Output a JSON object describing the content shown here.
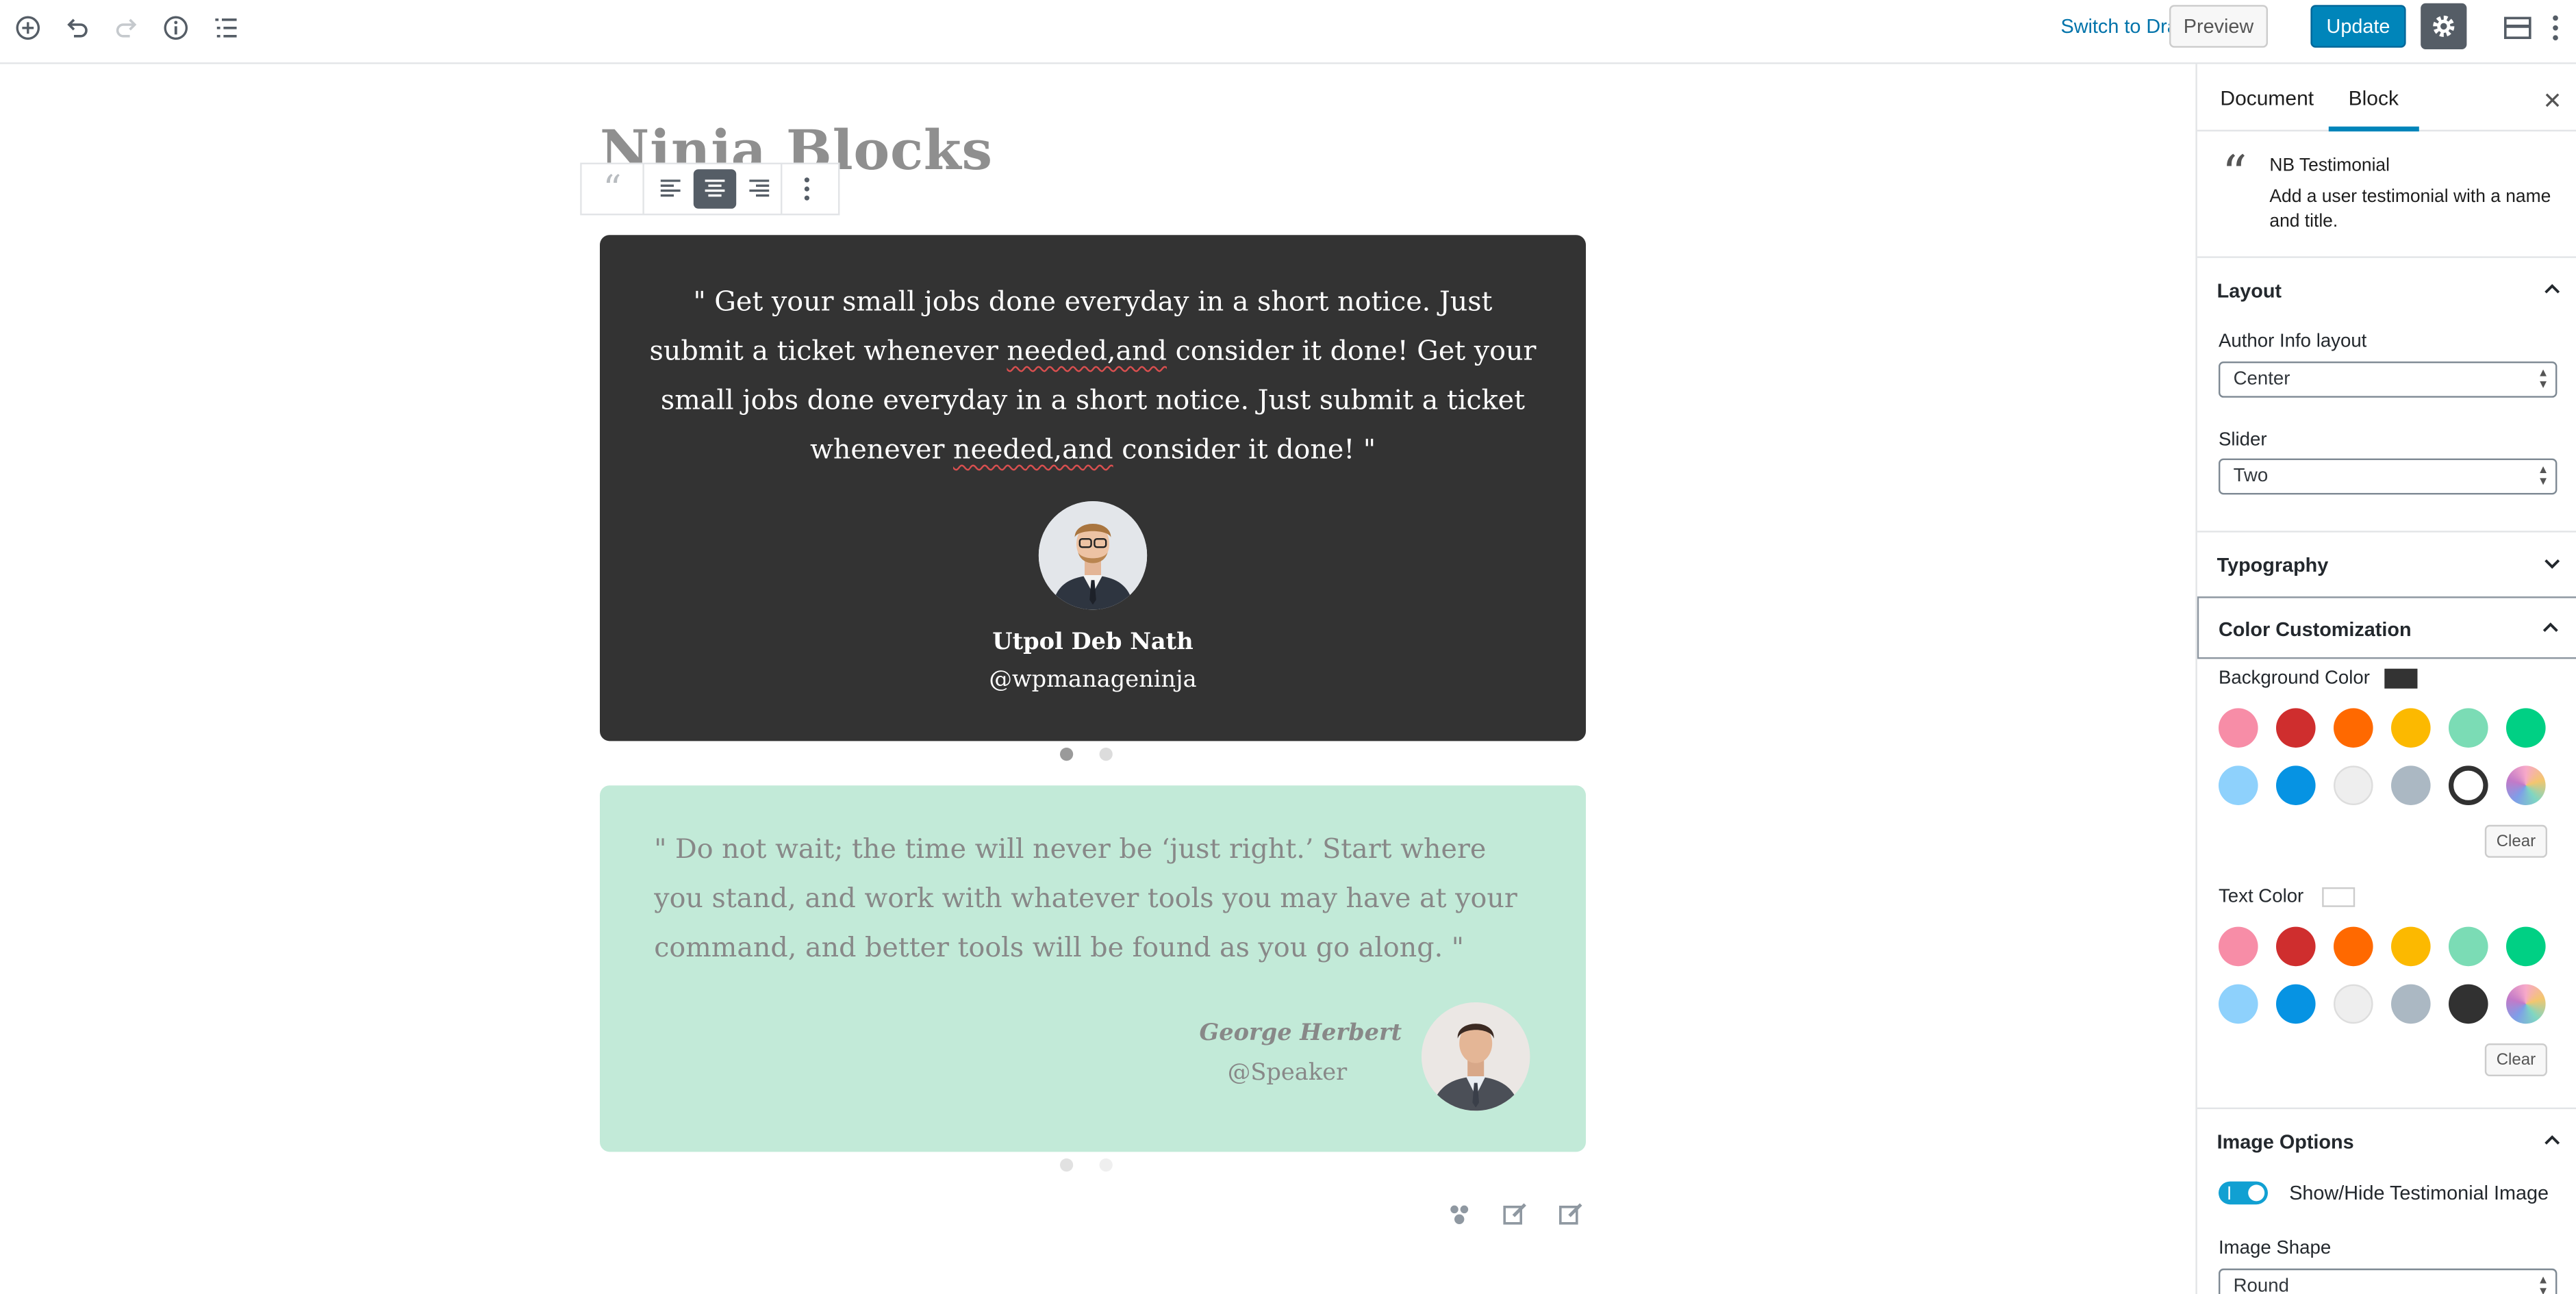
{
  "toolbar": {
    "switch_to_draft": "Switch to Draft",
    "preview": "Preview",
    "update": "Update",
    "icons": [
      "add-block-icon",
      "undo-icon",
      "redo-icon",
      "info-icon",
      "list-view-icon",
      "settings-gear-icon",
      "fullwidth-icon",
      "more-options-icon"
    ]
  },
  "editor": {
    "post_title": "Ninja Blocks",
    "testimonial_1": {
      "quote_a": "\" Get your small jobs done everyday in a short notice. Just submit a ticket whenever ",
      "quote_spell_1": "needed,and",
      "quote_b": " consider it done! Get your small jobs done everyday in a short notice. Just submit a ticket whenever ",
      "quote_spell_2": "needed,and",
      "quote_c": " consider it done! \"",
      "name": "Utpol Deb Nath",
      "handle": "@wpmanageninja",
      "background": "#333333"
    },
    "testimonial_2": {
      "quote": "\" Do not wait; the time will never be ‘just right.’ Start where you stand, and work with whatever tools you may have at your command, and better tools will be found as you go along. \"",
      "name": "George Herbert",
      "handle": "@Speaker",
      "background": "#c2ead8"
    }
  },
  "sidebar": {
    "tabs": [
      "Document",
      "Block"
    ],
    "active_tab": "Block",
    "block_info": {
      "title": "NB Testimonial",
      "description": "Add a user testimonial with a name and title."
    },
    "layout": {
      "title": "Layout",
      "author_info_label": "Author Info layout",
      "author_info_value": "Center",
      "slider_label": "Slider",
      "slider_value": "Two"
    },
    "typography": {
      "title": "Typography"
    },
    "color_customization": {
      "title": "Color Customization",
      "background_label": "Background Color",
      "text_label": "Text Color",
      "clear": "Clear",
      "palette": [
        "#f78da7",
        "#cf2e2e",
        "#ff6900",
        "#fcb900",
        "#7bdcb5",
        "#00d084",
        "#8ed1fc",
        "#0693e3",
        "#eeeeee",
        "#abb8c3",
        "#313131",
        "gradient"
      ]
    },
    "image_options": {
      "title": "Image Options",
      "toggle_label": "Show/Hide Testimonial Image",
      "shape_label": "Image Shape",
      "shape_value": "Round"
    }
  }
}
